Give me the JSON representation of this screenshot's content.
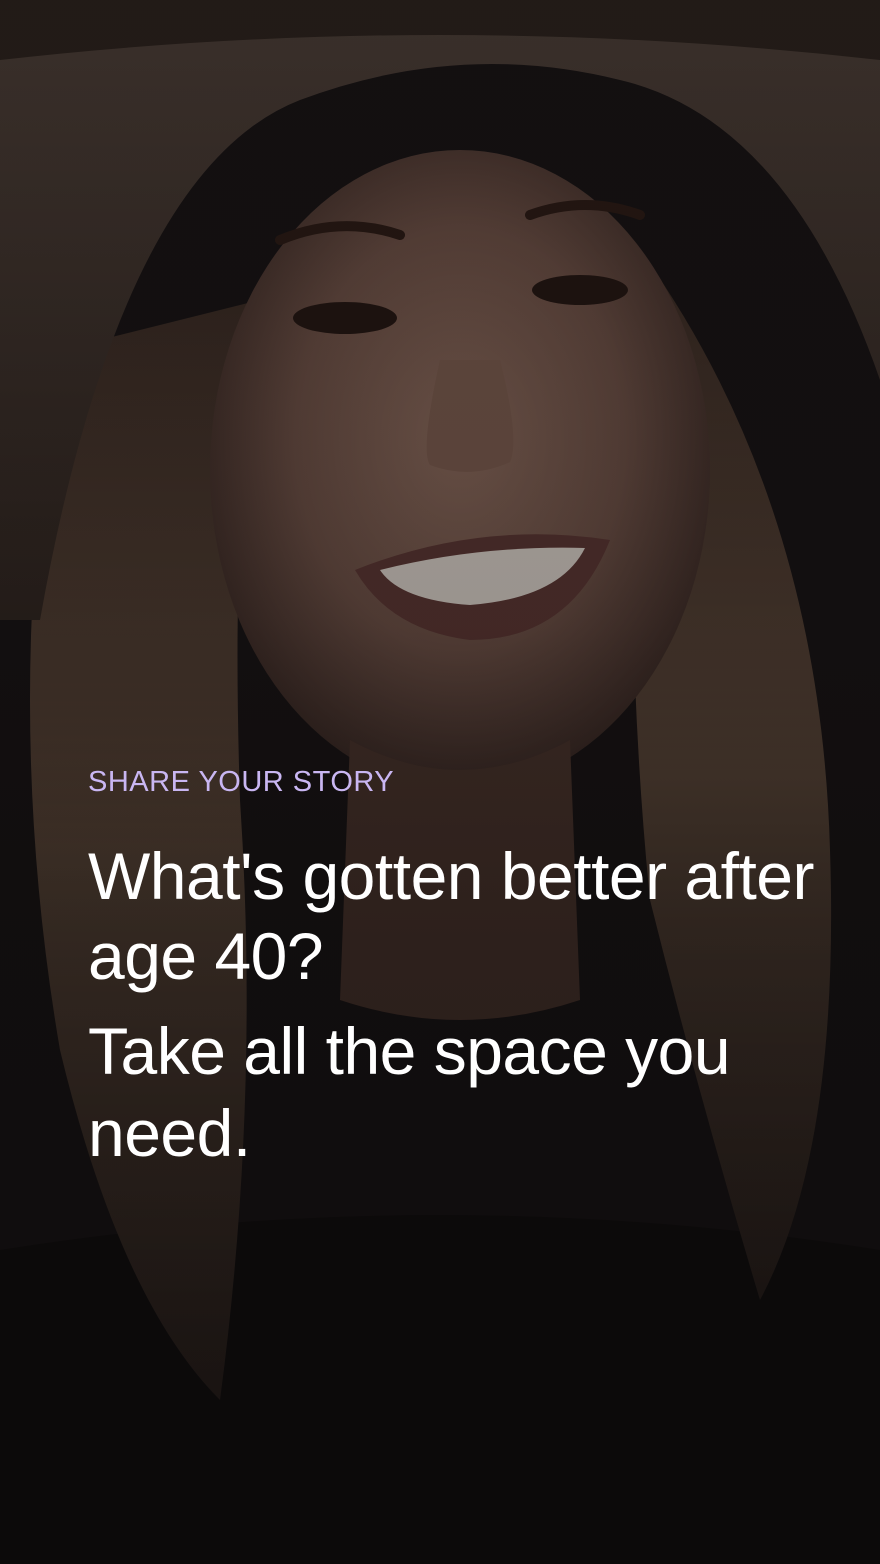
{
  "story": {
    "eyebrow": "SHARE YOUR STORY",
    "headline": "What's gotten better after age 40?",
    "subhead": "Take all the space you need."
  },
  "colors": {
    "eyebrow": "#c9b6f2",
    "text": "#ffffff",
    "background": "#151112"
  }
}
